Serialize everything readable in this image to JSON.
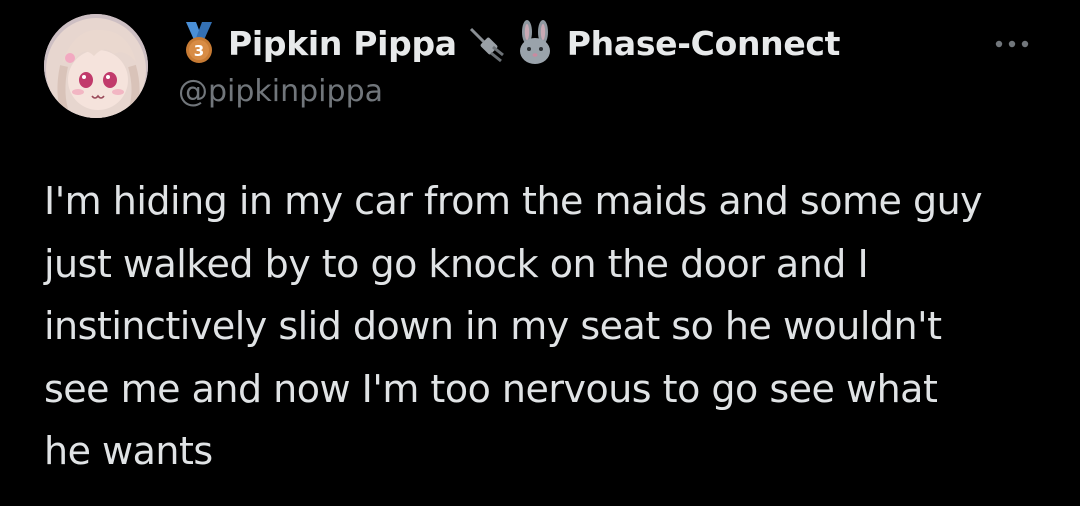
{
  "tweet": {
    "author": {
      "display_name": "Pipkin Pippa",
      "affiliation": "Phase-Connect",
      "handle": "@pipkinpippa",
      "badge_icon": "medal-3-icon",
      "plug_icon": "plug-icon",
      "affiliation_icon": "bunny-icon"
    },
    "more_icon": "more-icon",
    "text": "I'm hiding in my car from the maids and some guy\njust walked by to go knock on the door and I\ninstinctively slid down in my seat so he wouldn't\nsee me and now I'm too nervous to go see what\nhe wants"
  },
  "colors": {
    "background": "#000000",
    "primary_text": "#e7e9ea",
    "secondary_text": "#71767b",
    "medal_bronze": "#c77b34",
    "medal_ribbon": "#4a8fd6"
  }
}
